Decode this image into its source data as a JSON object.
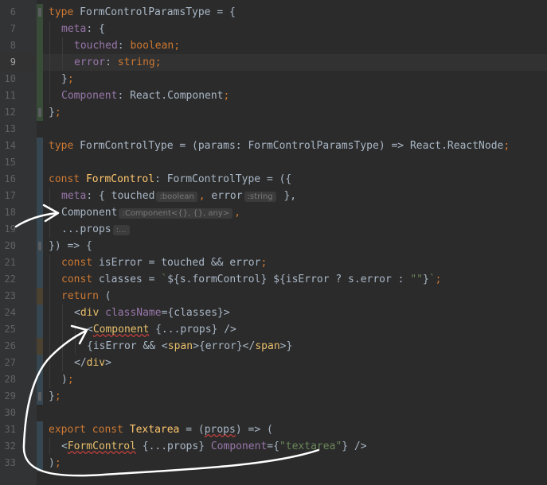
{
  "colors": {
    "background": "#2b2b2b",
    "gutter": "#313335",
    "current_line": "#323232",
    "keyword": "#cc7832",
    "property": "#9876aa",
    "string": "#6a8759",
    "text": "#a9b7c6",
    "tag": "#e8bf6a",
    "function": "#ffc66d",
    "hint_text": "#787878",
    "hint_bg": "#3b3b3b",
    "change_added": "#384c38",
    "change_modified": "#374752",
    "change_other": "#4b4131",
    "annotation": "#ffffff"
  },
  "current_line": "9",
  "lines": [
    {
      "n": "6",
      "mark": "g",
      "indent": 0,
      "fold": true,
      "segs": [
        [
          "type",
          "kw"
        ],
        [
          " ",
          ""
        ],
        [
          "FormControlParamsType",
          "t"
        ],
        [
          " = {",
          ""
        ]
      ]
    },
    {
      "n": "7",
      "mark": "g",
      "indent": 1,
      "segs": [
        [
          "meta",
          "p"
        ],
        [
          ": {",
          ""
        ]
      ]
    },
    {
      "n": "8",
      "mark": "g",
      "indent": 2,
      "segs": [
        [
          "touched",
          "p"
        ],
        [
          ": ",
          ""
        ],
        [
          "boolean",
          "kw"
        ],
        [
          ";",
          "kw"
        ]
      ]
    },
    {
      "n": "9",
      "mark": "g",
      "indent": 2,
      "segs": [
        [
          "error",
          "p"
        ],
        [
          ": ",
          ""
        ],
        [
          "string",
          "kw"
        ],
        [
          ";",
          "kw"
        ]
      ]
    },
    {
      "n": "10",
      "mark": "g",
      "indent": 1,
      "segs": [
        [
          "}",
          ""
        ],
        [
          ";",
          "kw"
        ]
      ]
    },
    {
      "n": "11",
      "mark": "g",
      "indent": 1,
      "segs": [
        [
          "Component",
          "p"
        ],
        [
          ": React.Component",
          ""
        ],
        [
          ";",
          "kw"
        ]
      ]
    },
    {
      "n": "12",
      "mark": "g",
      "indent": 0,
      "fold": true,
      "segs": [
        [
          "}",
          ""
        ],
        [
          ";",
          "kw"
        ]
      ]
    },
    {
      "n": "13",
      "mark": "",
      "indent": 0,
      "segs": []
    },
    {
      "n": "14",
      "mark": "b",
      "indent": 0,
      "segs": [
        [
          "type",
          "kw"
        ],
        [
          " FormControlType = (params: FormControlParamsType) => React.ReactNode",
          ""
        ],
        [
          ";",
          "kw"
        ]
      ]
    },
    {
      "n": "15",
      "mark": "b",
      "indent": 0,
      "segs": []
    },
    {
      "n": "16",
      "mark": "b",
      "indent": 0,
      "segs": [
        [
          "const",
          "kw"
        ],
        [
          " ",
          ""
        ],
        [
          "FormControl",
          "fn"
        ],
        [
          ": FormControlType = ({",
          ""
        ]
      ]
    },
    {
      "n": "17",
      "mark": "b",
      "indent": 1,
      "segs": [
        [
          "meta",
          "p"
        ],
        [
          ": { touched",
          ""
        ],
        [
          ":boolean",
          "hint"
        ],
        [
          ", ",
          "kw"
        ],
        [
          "error",
          ""
        ],
        [
          ":string",
          "hint"
        ],
        [
          " },",
          ""
        ]
      ]
    },
    {
      "n": "18",
      "mark": "b",
      "indent": 1,
      "segs": [
        [
          "Component",
          ""
        ],
        [
          ":Component<{}, {}, any>",
          "hint"
        ],
        [
          ", ",
          "kw"
        ]
      ]
    },
    {
      "n": "19",
      "mark": "b",
      "indent": 1,
      "segs": [
        [
          "...props",
          ""
        ],
        [
          ":...",
          "hint"
        ]
      ]
    },
    {
      "n": "20",
      "mark": "b",
      "indent": 0,
      "fold": true,
      "segs": [
        [
          "}) => {",
          ""
        ]
      ]
    },
    {
      "n": "21",
      "mark": "b",
      "indent": 1,
      "segs": [
        [
          "const",
          "kw"
        ],
        [
          " isError = touched && error",
          ""
        ],
        [
          ";",
          "kw"
        ]
      ]
    },
    {
      "n": "22",
      "mark": "b",
      "indent": 1,
      "segs": [
        [
          "const",
          "kw"
        ],
        [
          " classes = ",
          ""
        ],
        [
          "`",
          "s"
        ],
        [
          "${",
          ""
        ],
        [
          "s.formControl",
          ""
        ],
        [
          "}",
          ""
        ],
        [
          " ",
          "s"
        ],
        [
          "${",
          ""
        ],
        [
          "isError ? s.error : ",
          ""
        ],
        [
          "\"\"",
          "s"
        ],
        [
          "}",
          ""
        ],
        [
          "`",
          "s"
        ],
        [
          ";",
          "kw"
        ]
      ]
    },
    {
      "n": "23",
      "mark": "o",
      "indent": 1,
      "segs": [
        [
          "return",
          "kw"
        ],
        [
          " (",
          ""
        ]
      ]
    },
    {
      "n": "24",
      "mark": "b",
      "indent": 2,
      "segs": [
        [
          "<",
          ""
        ],
        [
          "div",
          "tag"
        ],
        [
          " ",
          ""
        ],
        [
          "className",
          "p"
        ],
        [
          "={classes}>",
          ""
        ]
      ]
    },
    {
      "n": "25",
      "mark": "b",
      "indent": 3,
      "segs": [
        [
          "<",
          ""
        ],
        [
          "Component",
          "tagsq"
        ],
        [
          " {...props} />",
          ""
        ]
      ]
    },
    {
      "n": "26",
      "mark": "o",
      "indent": 3,
      "segs": [
        [
          "{isError && <",
          ""
        ],
        [
          "span",
          "tag"
        ],
        [
          ">{error}</",
          ""
        ],
        [
          "span",
          "tag"
        ],
        [
          ">}",
          ""
        ]
      ]
    },
    {
      "n": "27",
      "mark": "b",
      "indent": 2,
      "segs": [
        [
          "</",
          ""
        ],
        [
          "div",
          "tag"
        ],
        [
          ">",
          ""
        ]
      ]
    },
    {
      "n": "28",
      "mark": "b",
      "indent": 1,
      "segs": [
        [
          ")",
          ""
        ],
        [
          ";",
          "kw"
        ]
      ]
    },
    {
      "n": "29",
      "mark": "b",
      "indent": 0,
      "fold": true,
      "segs": [
        [
          "}",
          ""
        ],
        [
          ";",
          "kw"
        ]
      ]
    },
    {
      "n": "30",
      "mark": "",
      "indent": 0,
      "segs": []
    },
    {
      "n": "31",
      "mark": "b",
      "indent": 0,
      "segs": [
        [
          "export",
          "kw"
        ],
        [
          " ",
          ""
        ],
        [
          "const",
          "kw"
        ],
        [
          " ",
          ""
        ],
        [
          "Textarea",
          "fn"
        ],
        [
          " = (",
          ""
        ],
        [
          "props",
          "sq"
        ],
        [
          ") => (",
          ""
        ]
      ]
    },
    {
      "n": "32",
      "mark": "b",
      "indent": 1,
      "segs": [
        [
          "<",
          ""
        ],
        [
          "FormControl",
          "tagsq"
        ],
        [
          " {...props} ",
          ""
        ],
        [
          "Component",
          "p"
        ],
        [
          "={",
          ""
        ],
        [
          "\"textarea\"",
          "s"
        ],
        [
          "} />",
          ""
        ]
      ]
    },
    {
      "n": "33",
      "mark": "b",
      "indent": 0,
      "segs": [
        [
          ")",
          ""
        ],
        [
          ";",
          "kw"
        ]
      ]
    }
  ]
}
